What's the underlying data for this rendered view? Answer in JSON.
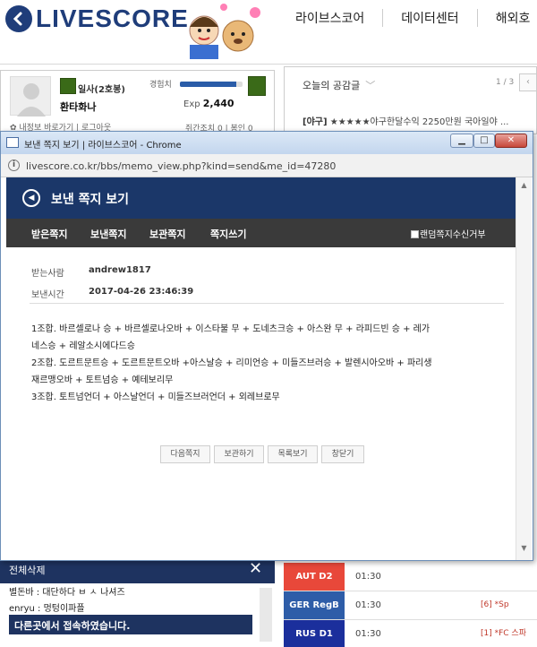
{
  "site": {
    "logo_text": "LIVESCORE",
    "nav": [
      "라이브스코어",
      "데이터센터",
      "해외호"
    ]
  },
  "user_panel": {
    "rank": "일사(2호봉)",
    "name": "환타화나",
    "links": "✿ 내정보  바로가기  |  로그아웃",
    "exp_label": "경험치",
    "exp_prefix": "Exp",
    "exp_value": "2,440",
    "exp_progress_percent": 90,
    "stats": "쥐간조치 0  |  봉인 0"
  },
  "empathy_panel": {
    "title": "오늘의 공감글",
    "pager": "1 / 3",
    "item_tag": "[야구]",
    "item_text": "★★★★★야구한달수익 2250만원 국아일야 ..."
  },
  "popup": {
    "title": "보낸 쪽지 보기 | 라이브스코어 - Chrome",
    "url": "livescore.co.kr/bbs/memo_view.php?kind=send&me_id=47280",
    "header_title": "보낸 쪽지 보기",
    "tabs": [
      "받은쪽지",
      "보낸쪽지",
      "보관쪽지",
      "쪽지쓰기"
    ],
    "refuse_label": "랜덤쪽지수신거부",
    "recipient_label": "받는사람",
    "recipient_value": "andrew1817",
    "sent_time_label": "보낸시간",
    "sent_time_value": "2017-04-26 23:46:39",
    "content_lines": [
      "1조합. 바르셀로나 승 + 바르셀로나오바 + 이스타불 무 + 도네츠크승 + 아스완 무 + 라피드빈 승 +   레가",
      "네스승 + 레알소시에다드승",
      "2조합. 도르트문트승 + 도르트문트오바 +아스날승 + 리미언승 + 미들즈브러승 +   발렌시아오바 + 파리생",
      "재르맹오바 + 토트넘승  + 예테보리무",
      "3조합. 토트넘언더 + 아스날언더 + 미들즈브러언더 + 외레브로무"
    ],
    "buttons": [
      "다음쪽지",
      "보관하기",
      "목록보기",
      "창닫기"
    ],
    "window_buttons": {
      "minimize": "▁",
      "maximize": "□",
      "close": "✕"
    }
  },
  "chat_panel": {
    "tab_label": "전체삭제",
    "close_label": "✕",
    "lines": [
      "별돈바 : 대단하다 ㅂ ㅅ 나셔즈",
      "enryu : 멍텅이파플"
    ],
    "notice": "다른곳에서 접속하였습니다."
  },
  "scores": [
    {
      "league": "AUT D2",
      "time": "01:30",
      "match": "",
      "color": "#e8483a"
    },
    {
      "league": "GER RegB",
      "time": "01:30",
      "match": "[6] *Sp",
      "color": "#2e5da8"
    },
    {
      "league": "RUS D1",
      "time": "01:30",
      "match": "[1] *FC 스파",
      "color": "#1b2f9c"
    }
  ]
}
